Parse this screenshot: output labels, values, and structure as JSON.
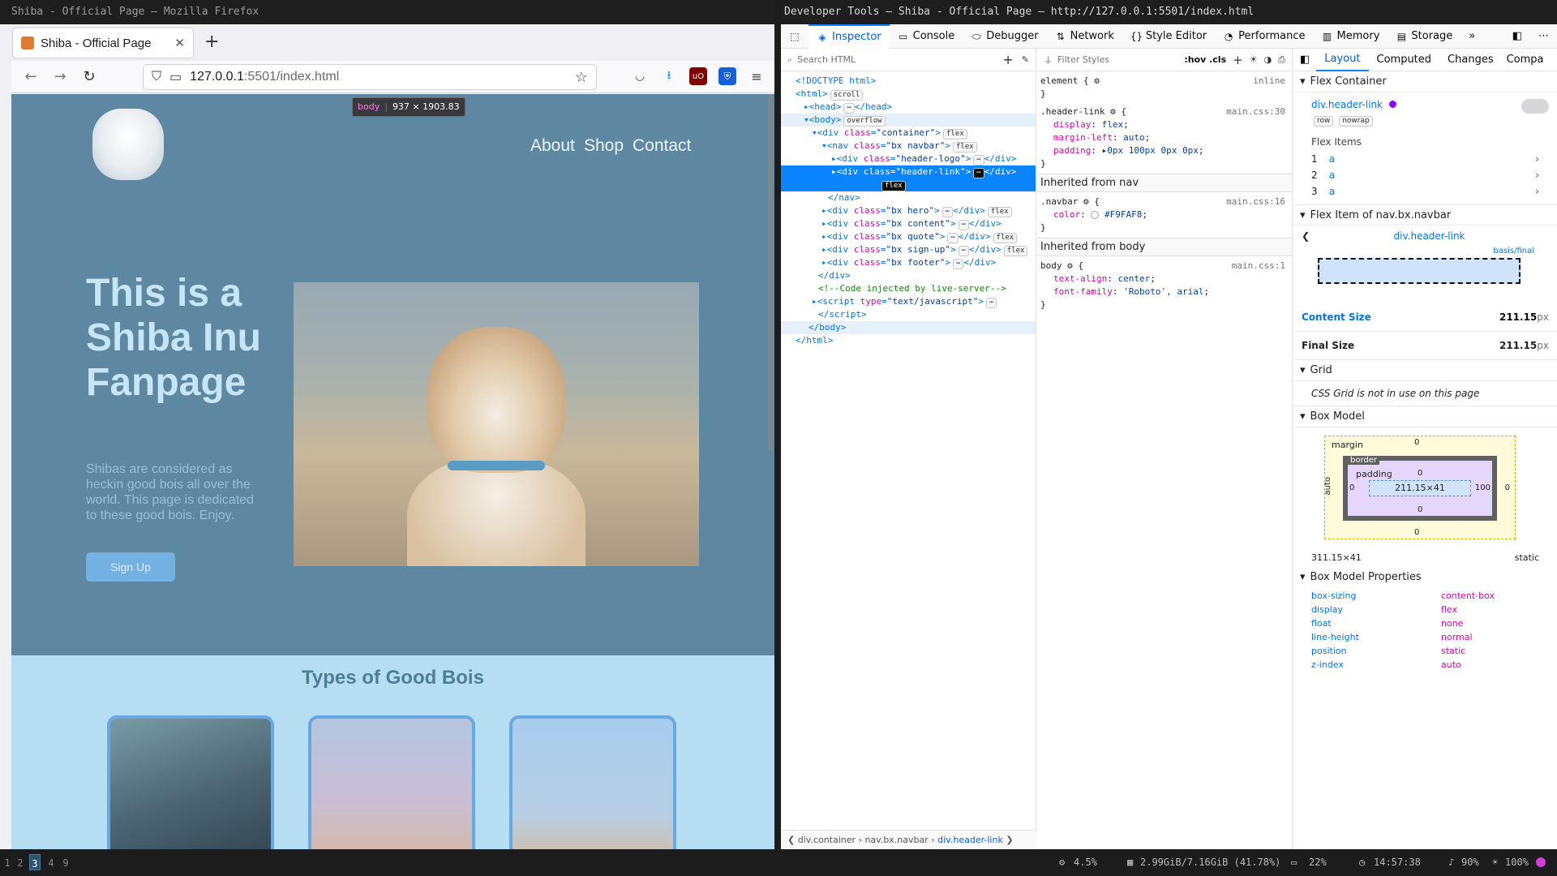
{
  "firefox": {
    "window_title": "Shiba - Official Page — Mozilla Firefox",
    "tab_title": "Shiba - Official Page",
    "url_host": "127.0.0.1",
    "url_path": ":5501/index.html",
    "page": {
      "nav_links": [
        "About",
        "Shop",
        "Contact"
      ],
      "hero_title": "This is a Shiba Inu Fanpage",
      "hero_text": "Shibas are considered as heckin good bois all over the world. This page is dedicated to these good bois. Enjoy.",
      "hero_button": "Sign Up",
      "section_title": "Types of Good Bois"
    },
    "tooltip": {
      "tag": "body",
      "size": "937 × 1903.83"
    }
  },
  "devtools": {
    "window_title": "Developer Tools — Shiba - Official Page — http://127.0.0.1:5501/index.html",
    "tabs": [
      "Inspector",
      "Console",
      "Debugger",
      "Network",
      "Style Editor",
      "Performance",
      "Memory",
      "Storage"
    ],
    "search_placeholder": "Search HTML",
    "filter_placeholder": "Filter Styles",
    "pseudo_toggle": ":hov .cls",
    "breadcrumb": [
      "div.container",
      "nav.bx.navbar",
      "div.header-link"
    ],
    "layout_tabs": [
      "Layout",
      "Computed",
      "Changes",
      "Compat"
    ],
    "flex_container_label": "Flex Container",
    "flex_container_selector": "div.header-link",
    "flex_container_badges": [
      "row",
      "nowrap"
    ],
    "flex_items_label": "Flex Items",
    "flex_items": [
      {
        "n": "1",
        "tag": "a"
      },
      {
        "n": "2",
        "tag": "a"
      },
      {
        "n": "3",
        "tag": "a"
      }
    ],
    "flex_item_of_label": "Flex Item of nav.bx.navbar",
    "flex_item_selector": "div.header-link",
    "basis_label": "basis/final",
    "content_size_label": "Content Size",
    "content_size": "211.15",
    "final_size_label": "Final Size",
    "final_size": "211.15",
    "px_unit": "px",
    "grid_label": "Grid",
    "grid_note": "CSS Grid is not in use on this page",
    "box_model_label": "Box Model",
    "box_margin": "margin",
    "box_border": "border",
    "box_padding": "padding",
    "box_content": "211.15×41",
    "box_size": "311.15×41",
    "box_position": "static",
    "box_values": {
      "auto": "auto",
      "zero": "0",
      "hundred": "100"
    },
    "box_props_label": "Box Model Properties",
    "box_props": [
      {
        "k": "box-sizing",
        "v": "content-box"
      },
      {
        "k": "display",
        "v": "flex"
      },
      {
        "k": "float",
        "v": "none"
      },
      {
        "k": "line-height",
        "v": "normal"
      },
      {
        "k": "position",
        "v": "static"
      },
      {
        "k": "z-index",
        "v": "auto"
      }
    ],
    "rules": {
      "element_selector": "element {",
      "element_src": "inline",
      "rule1_selector": ".header-link",
      "rule1_src": "main.css:30",
      "rule1_props": [
        {
          "k": "display",
          "v": "flex"
        },
        {
          "k": "margin-left",
          "v": "auto"
        },
        {
          "k": "padding",
          "v": "0px 100px 0px 0px"
        }
      ],
      "inherit_nav": "Inherited from nav",
      "rule2_selector": ".navbar",
      "rule2_src": "main.css:16",
      "rule2_props": [
        {
          "k": "color",
          "v": "#F9FAF8"
        }
      ],
      "inherit_body": "Inherited from body",
      "rule3_selector": "body",
      "rule3_src": "main.css:1",
      "rule3_props": [
        {
          "k": "text-align",
          "v": "center"
        },
        {
          "k": "font-family",
          "v": "'Roboto', arial"
        }
      ]
    }
  },
  "taskbar": {
    "workspaces": [
      "1",
      "2",
      "3",
      "4",
      "9"
    ],
    "active_workspace": "3",
    "cpu": "4.5%",
    "memory": "2.99GiB/7.16GiB (41.78%)",
    "battery": "22%",
    "time": "14:57:38",
    "volume": "90%",
    "brightness": "100%"
  },
  "colors": {
    "hero_bg": "#5e88a2",
    "section_bg": "#b6def2",
    "accent": "#0a84ff"
  }
}
